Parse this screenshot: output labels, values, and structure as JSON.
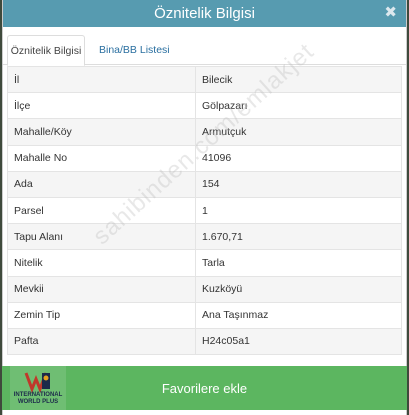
{
  "dialog": {
    "title": "Öznitelik Bilgisi",
    "close_icon": "close-icon",
    "close_glyph": "✖"
  },
  "tabs": [
    {
      "label": "Öznitelik Bilgisi",
      "active": true
    },
    {
      "label": "Bina/BB Listesi",
      "active": false
    }
  ],
  "rows": [
    {
      "key": "İl",
      "value": "Bilecik"
    },
    {
      "key": "İlçe",
      "value": "Gölpazarı"
    },
    {
      "key": "Mahalle/Köy",
      "value": "Armutçuk"
    },
    {
      "key": "Mahalle No",
      "value": "41096"
    },
    {
      "key": "Ada",
      "value": "154"
    },
    {
      "key": "Parsel",
      "value": "1"
    },
    {
      "key": "Tapu Alanı",
      "value": "1.670,71"
    },
    {
      "key": "Nitelik",
      "value": "Tarla"
    },
    {
      "key": "Mevkii",
      "value": "Kuzköyü"
    },
    {
      "key": "Zemin Tip",
      "value": "Ana Taşınmaz"
    },
    {
      "key": "Pafta",
      "value": "H24c05a1"
    }
  ],
  "watermark": "sahibinden.com/emlakjet",
  "footer": {
    "favorite_label": "Favorilere ekle"
  },
  "logo": {
    "line1": "INTERNATIONAL",
    "line2": "WORLD PLUS"
  },
  "colors": {
    "header": "#579bb0",
    "favorite_button": "#5cb660",
    "tab_link": "#2a6fa0"
  }
}
